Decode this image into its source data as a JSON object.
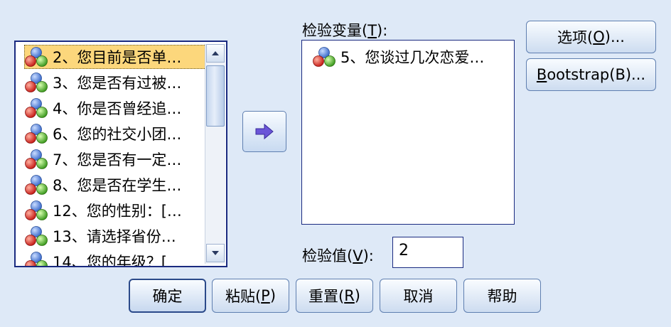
{
  "source_list": {
    "items": [
      {
        "label": "2、您目前是否单…",
        "selected": true
      },
      {
        "label": "3、您是否有过被…",
        "selected": false
      },
      {
        "label": "4、你是否曾经追…",
        "selected": false
      },
      {
        "label": "6、您的社交小团…",
        "selected": false
      },
      {
        "label": "7、您是否有一定…",
        "selected": false
      },
      {
        "label": "8、您是否在学生…",
        "selected": false
      },
      {
        "label": "12、您的性别：[…",
        "selected": false
      },
      {
        "label": "13、请选择省份…",
        "selected": false
      },
      {
        "label": "14、您的年级？[",
        "selected": false
      }
    ]
  },
  "test_variables": {
    "label_before": "检验变量(",
    "mnemonic": "T",
    "label_after": "):",
    "items": [
      {
        "label": "5、您谈过几次恋爱…"
      }
    ]
  },
  "test_value": {
    "label_before": "检验值(",
    "mnemonic": "V",
    "label_after": "):",
    "value": "2"
  },
  "side_buttons": {
    "options": {
      "before": "选项(",
      "mnemonic": "O",
      "after": ")..."
    },
    "bootstrap": {
      "before": "",
      "mnemonic": "B",
      "after": "ootstrap(B)..."
    }
  },
  "bottom_buttons": {
    "ok": "确定",
    "paste": {
      "before": "粘贴(",
      "mnemonic": "P",
      "after": ")"
    },
    "reset": {
      "before": "重置(",
      "mnemonic": "R",
      "after": ")"
    },
    "cancel": "取消",
    "help": "帮助"
  },
  "icons": {
    "variable_icon": "nominal-variable-icon",
    "move_arrow": "arrow-right-icon"
  },
  "colors": {
    "background": "#dee9f7",
    "selection": "#fcd77c",
    "border": "#1a2a80"
  }
}
